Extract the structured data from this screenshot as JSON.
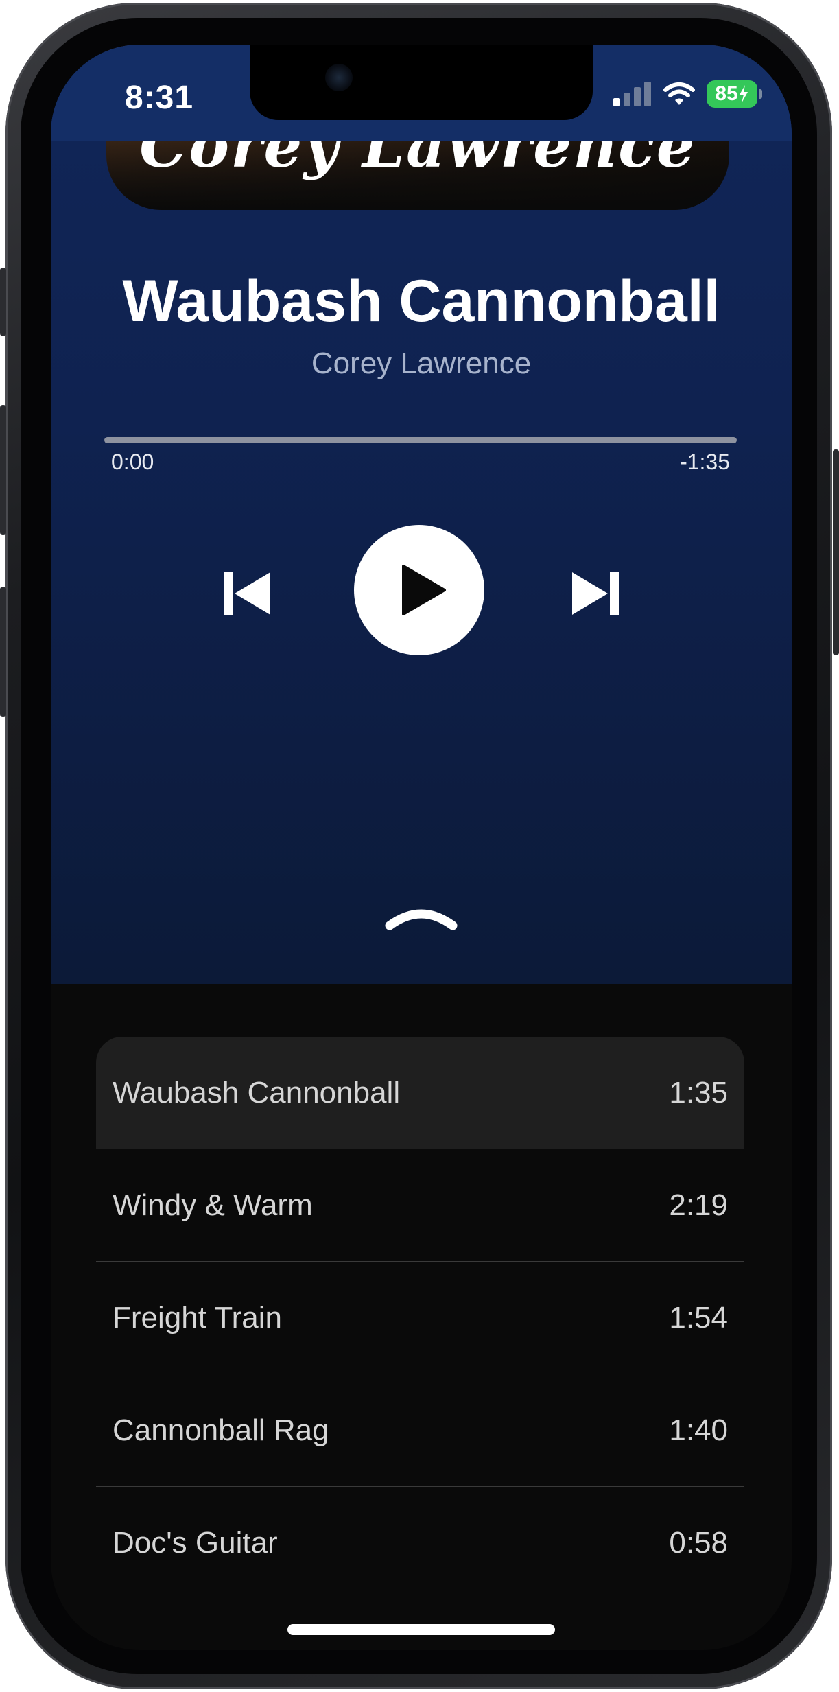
{
  "status_bar": {
    "time": "8:31",
    "battery": "85",
    "signal_icon": "cellular-signal-icon",
    "wifi_icon": "wifi-icon",
    "charging_icon": "bolt-icon"
  },
  "album": {
    "script_text": "Corey Lawrence"
  },
  "now_playing": {
    "title": "Waubash Cannonball",
    "artist": "Corey Lawrence",
    "elapsed": "0:00",
    "remaining": "-1:35",
    "progress": 0
  },
  "controls": {
    "previous_icon": "skip-previous-icon",
    "play_icon": "play-icon",
    "next_icon": "skip-next-icon",
    "expand_icon": "chevron-up-icon"
  },
  "playlist": [
    {
      "name": "Waubash Cannonball",
      "duration": "1:35",
      "active": true
    },
    {
      "name": "Windy & Warm",
      "duration": "2:19",
      "active": false
    },
    {
      "name": "Freight Train",
      "duration": "1:54",
      "active": false
    },
    {
      "name": "Cannonball Rag",
      "duration": "1:40",
      "active": false
    },
    {
      "name": "Doc's Guitar",
      "duration": "0:58",
      "active": false
    }
  ],
  "colors": {
    "player_bg": "#112658",
    "status_bg": "#142e66",
    "playlist_bg": "#0a0a0a",
    "active_row": "#1f1f1f",
    "battery": "#34c759"
  }
}
